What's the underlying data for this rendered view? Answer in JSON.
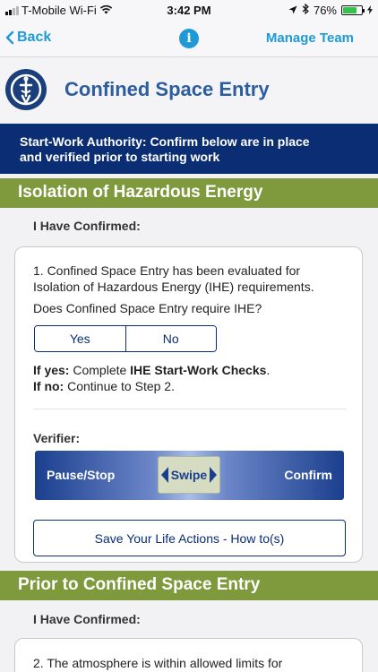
{
  "status_bar": {
    "carrier": "T-Mobile Wi-Fi",
    "time": "3:42 PM",
    "battery": "76%",
    "battery_level": 0.76,
    "battery_color": "#35c24a"
  },
  "nav": {
    "back_label": "Back",
    "info_icon": "i",
    "manage_label": "Manage Team"
  },
  "header": {
    "title": "Confined Space Entry"
  },
  "authority": {
    "line1": "Start-Work Authority: Confirm below are in place",
    "line2": "and verified prior to starting work"
  },
  "sections": [
    {
      "title": "Isolation of Hazardous Energy",
      "confirmed_label": "I Have Confirmed:",
      "question_line1": "1. Confined Space Entry has been evaluated for",
      "question_line2": "Isolation of Hazardous Energy (IHE) requirements.",
      "ihe_question": "Does Confined Space Entry require IHE?",
      "options": [
        "Yes",
        "No"
      ],
      "if_yes_label": "If yes:",
      "if_yes_text_before": " Complete ",
      "if_yes_strong": "IHE Start-Work Checks",
      "if_yes_text_after": ".",
      "if_no_label": "If no:",
      "if_no_text": " Continue to Step 2.",
      "verifier_label": "Verifier:",
      "swipe": {
        "left_label": "Pause/Stop",
        "handle_label": "Swipe",
        "right_label": "Confirm"
      },
      "action_button": "Save Your Life Actions - How to(s)"
    },
    {
      "title": "Prior to Confined Space Entry",
      "confirmed_label": "I Have Confirmed:",
      "question": "2. The atmosphere is within allowed limits for"
    }
  ],
  "colors": {
    "accent_blue": "#1f9ad6",
    "navy": "#0a2d73",
    "section_green": "#7e9a3c",
    "title_blue": "#2c5d9e"
  }
}
